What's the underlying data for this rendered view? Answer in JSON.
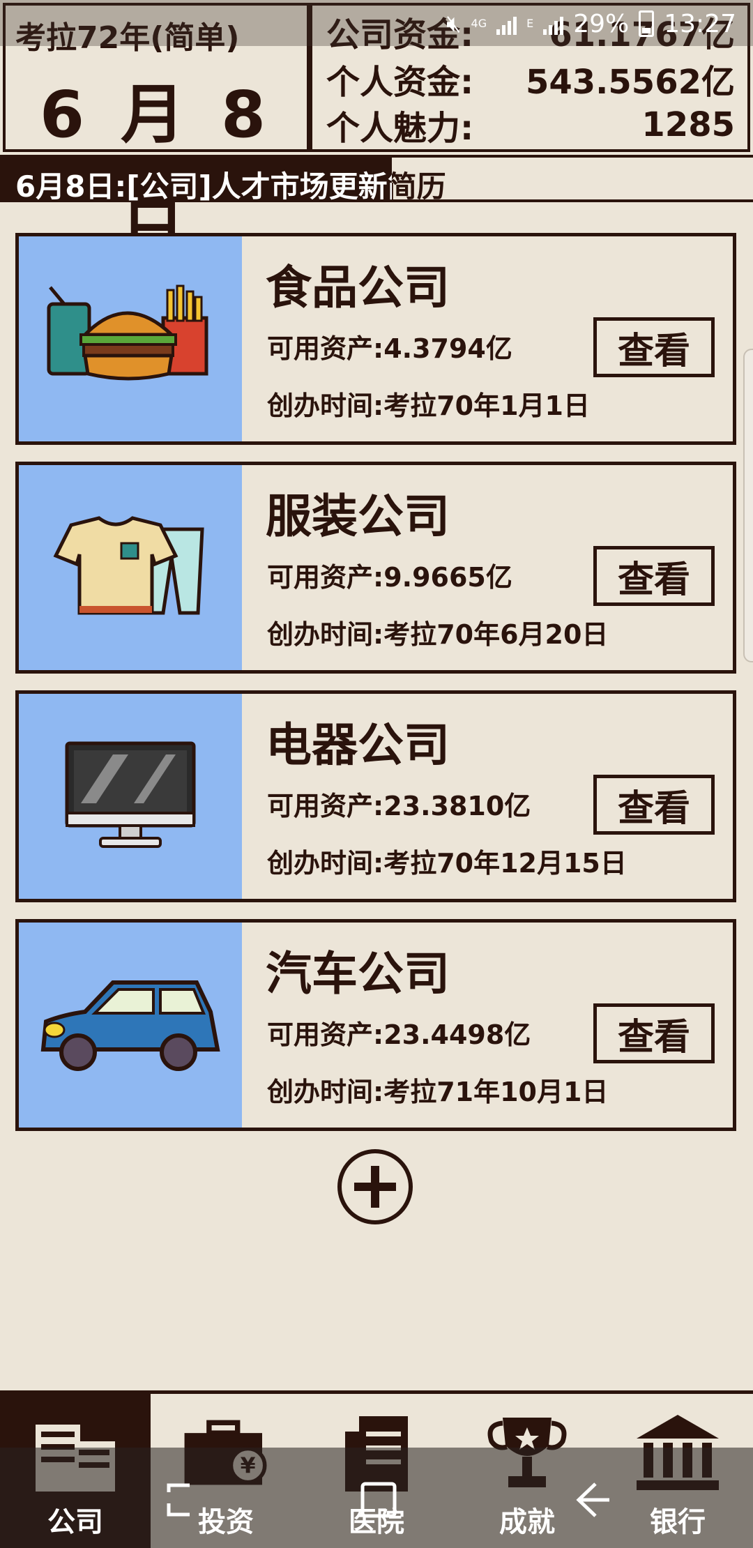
{
  "status_bar": {
    "network_top": "4G",
    "network_bottom": "4G 2G",
    "network_e": "E",
    "battery": "29%",
    "time": "13:27"
  },
  "header": {
    "year_mode": "考拉72年(简单)",
    "date": "6 月 8 日",
    "company_funds_label": "公司资金:",
    "company_funds_value": "61.1767亿",
    "personal_funds_label": "个人资金:",
    "personal_funds_value": "543.5562亿",
    "charm_label": "个人魅力:",
    "charm_value": "1285"
  },
  "news": {
    "text": "6月8日:[公司]人才市场更新简历"
  },
  "companies": [
    {
      "name": "食品公司",
      "assets": "可用资产:4.3794亿",
      "founded": "创办时间:考拉70年1月1日",
      "button": "查看",
      "icon": "burger-fries-icon"
    },
    {
      "name": "服装公司",
      "assets": "可用资产:9.9665亿",
      "founded": "创办时间:考拉70年6月20日",
      "button": "查看",
      "icon": "tshirt-pants-icon"
    },
    {
      "name": "电器公司",
      "assets": "可用资产:23.3810亿",
      "founded": "创办时间:考拉70年12月15日",
      "button": "查看",
      "icon": "monitor-icon"
    },
    {
      "name": "汽车公司",
      "assets": "可用资产:23.4498亿",
      "founded": "创办时间:考拉71年10月1日",
      "button": "查看",
      "icon": "car-icon"
    }
  ],
  "bottom_nav": [
    {
      "label": "公司",
      "icon": "building-icon",
      "active": true
    },
    {
      "label": "投资",
      "icon": "briefcase-yen-icon",
      "active": false
    },
    {
      "label": "医院",
      "icon": "hospital-icon",
      "active": false
    },
    {
      "label": "成就",
      "icon": "trophy-icon",
      "active": false
    },
    {
      "label": "银行",
      "icon": "bank-icon",
      "active": false
    }
  ],
  "colors": {
    "background": "#ece5d8",
    "ink": "#2a130c",
    "icon_panel": "#8fb8f2"
  }
}
